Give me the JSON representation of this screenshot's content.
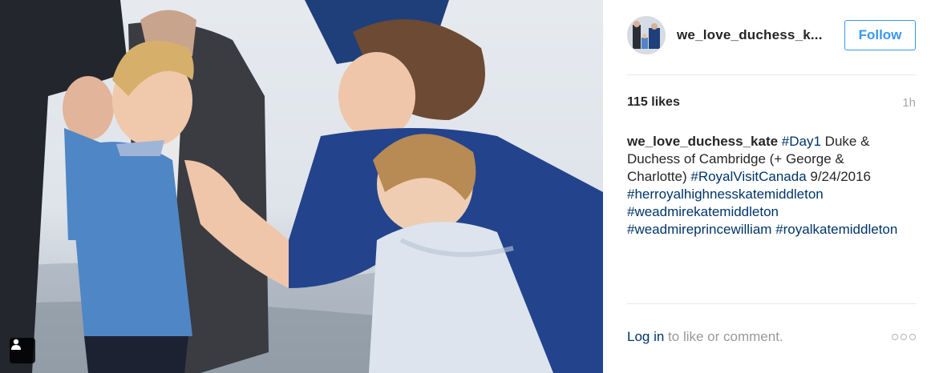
{
  "photo": {
    "description_icon": "user-tag-icon"
  },
  "header": {
    "username": "we_love_duchess_k...",
    "follow_label": "Follow"
  },
  "meta": {
    "likes": "115 likes",
    "time": "1h"
  },
  "caption": {
    "user": "we_love_duchess_kate",
    "segments": [
      {
        "type": "tag",
        "text": "#Day1"
      },
      {
        "type": "text",
        "text": " Duke & Duchess of Cambridge (+ George & Charlotte) "
      },
      {
        "type": "tag",
        "text": "#RoyalVisitCanada"
      },
      {
        "type": "text",
        "text": " 9/24/2016 "
      },
      {
        "type": "tag",
        "text": "#herroyalhighnesskatemiddleton"
      },
      {
        "type": "text",
        "text": " "
      },
      {
        "type": "tag",
        "text": "#weadmirekatemiddleton"
      },
      {
        "type": "text",
        "text": " "
      },
      {
        "type": "tag",
        "text": "#weadmireprincewilliam"
      },
      {
        "type": "text",
        "text": " "
      },
      {
        "type": "tag",
        "text": "#royalkatemiddleton"
      }
    ]
  },
  "footer": {
    "login_label": "Log in",
    "login_rest": " to like or comment.",
    "more_icon": "more-options-icon"
  },
  "colors": {
    "link_blue": "#003569",
    "follow_blue": "#3897f0",
    "muted": "#999999"
  }
}
